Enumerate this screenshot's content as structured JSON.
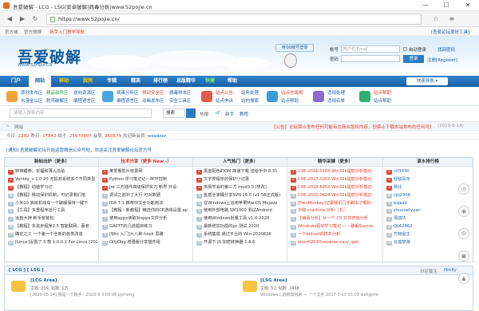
{
  "window": {
    "title": "吾爱破解 - LCG - LSG|安卓破解|病毒分析|www.52pojie.cn",
    "minimize": "—",
    "maximize": "☐",
    "close": "✕"
  },
  "browser": {
    "url": "https://www.52pojie.cn/"
  },
  "topbar": {
    "home": "官方域",
    "lock": "官方微博",
    "newbie": "新手入门教学导航",
    "tools": "[吾爱论坛爱好工具]"
  },
  "header": {
    "logo_text": "吾爱破解",
    "logo_url": "WWW.52PoJie.CN",
    "qq_login": "用QQ帐号登录",
    "account_label": "帐号",
    "account_placeholder": "用户名/Email",
    "password_label": "密码",
    "remember": "自动登录",
    "forgot": "找回密码",
    "login": "登录",
    "register": "注册[Register]"
  },
  "nav": {
    "items": [
      "门户",
      "网站",
      "移动",
      "脱壳",
      "专辑",
      "精英",
      "排行榜",
      "总版精华",
      "快捷",
      "帮助"
    ],
    "active_index": 1,
    "quick": "快速导航 ▾"
  },
  "subnav": {
    "groups": [
      {
        "a": "原创发布区",
        "b": "精品软件区",
        "c": "逆向资源区",
        "d": "水漫金山区",
        "e": "脱壳破解区",
        "f": "编程语言区"
      },
      {
        "a": "病毒分析区",
        "b": "移动安全区",
        "c": "病毒样本区",
        "d": "编程语言区",
        "e": "动画发布区",
        "f": "安全工具区"
      },
      {
        "a": "站点公告",
        "b": "站点申诉",
        "c": "悬赏任务"
      },
      {
        "a": "站务处理",
        "b": "站内搜索",
        "c": "站内问答"
      },
      {
        "a": "站点总版规",
        "b": "站点帮助"
      },
      {
        "a": "违规处理",
        "b": "违规名单"
      },
      {
        "a": "站点帮助",
        "b": "站点帮助"
      }
    ]
  },
  "search": {
    "placeholder": "请输入搜索内容",
    "select": "搜索",
    "hot_label": "热搜:",
    "hot": [
      "cf",
      "新手",
      "教程"
    ]
  },
  "crumb": {
    "home": "网站",
    "sub": "网站"
  },
  "notice": {
    "text": "【公告】论坛禁止发布任何可能有在商业版权内容，但禁止下载本站发布的任何可执行资源...",
    "date": "(2019-6-14)"
  },
  "stats": {
    "today_label": "今日:",
    "today": "2282",
    "yesterday_label": "昨日:",
    "yesterday": "17842",
    "posts_label": "帖子:",
    "posts": "25970907",
    "members_label": "会员:",
    "members": "960579",
    "newest_label": "欢迎新会员:",
    "newest": "wsadzzz"
  },
  "link_notice": {
    "text": "[通知] 吾爱破解论坛开始运营微信公众号啦，欢迎关注吾爱破解论坛官方号"
  },
  "table": {
    "headers": [
      "新帖出炉（更多）",
      "技术分享（更多 New -）",
      "人气热门（更多）",
      "精华采撷（更多）",
      "滚水排行榜"
    ],
    "col1": [
      "转锦鲤券，祈福和薄入瓜贴",
      "Ventoy_v 1.0.20 无损双系统多个不同类型",
      "【教程】动脑学习记",
      "【教程】移动保护机制，可记录我们信",
      "小米10 高级机动车一个破解保持一键下",
      "【工具】多重程序运行工具",
      "运盘大神 新手安装包",
      "【教程】多进步程序2.5 智能联网，蔡老",
      "确定之工 一个第一个全新的各类改造",
      "[Linux]设置了 5 款 1.0.0.1 For Linux [202"
    ],
    "col2": [
      "某爱看影片收录网",
      "Python 学习笔记记---MTF控制",
      "Jre 三方插件高级保护实力 新界 外设",
      "调试之前补丁大行 可对数据",
      "IDA 7.1 推荐中文全功能用法",
      "【教程 - 新教程】精选你的CE游戏设置 ap",
      "使用appx读取对appx文件分析",
      "GACTF的几道题目练习",
      "[Win 入门]九八种 hook 思路",
      "OllyDbg 增强版分享插件组"
    ],
    "col3": [
      "黑金配色的OM 高速下载 送给手中 8.31",
      "文字类程序的保护小记录",
      "简易学会的第三方 mod3.0 (修改)",
      "金盾全家桶分享SVN 16.0 (v1.58正式版)",
      "在Windows上运用苹果MacOS Mojave",
      "使用外部电路 SM1000 测试Android",
      "使用Windows批量工具 v1.0-2020",
      "最新增加功能的pc 测试 2020",
      "系统集成 通过平台的 Win-2020826",
      "开源下 JS 加密转换器 1.8.6"
    ],
    "col4": [
      "CVE-2016-0165 Win32k提权分析笔记",
      "CVE-2017-0263 Win32k提权分析笔记",
      "CVE-2018-8453 Win32k提权分析笔记",
      "CVE-2020-0624 Win32k提权分析笔记",
      "[PwnMonkey]记录我们几乎刷出了哪好",
      "中级 crackme 分析（五）",
      "【病毒分析】从一个 CS 文件开始分析",
      "Windows驱动学习笔记 ——破解Source",
      "一个botnet的样本分析",
      "wmctf2020 reverse easy_apk"
    ],
    "col5": [
      "ctl3330",
      "轻锐青年",
      "杨比",
      "cjtj2308",
      "bsjasd",
      "zhuxuetyuan",
      "周鸽华",
      "QL62862",
      "万物诞生",
      "云落梦游"
    ]
  },
  "lcg": {
    "title": "[ LCG ] [ LSG ]",
    "mod_label": "分区版主:",
    "mod": "Hmily",
    "left": {
      "name": "[LCG Area]",
      "desc": "主题: 239, 帖数: 1万",
      "last": "[2020-05-24] 我是一个新手，2020-9-3 00:06 pymong"
    },
    "right": {
      "name": "[LSG Area]",
      "desc": "主题: 51, 帖数: 2468",
      "last": "Windows二进制如何来 — 一个文件 2017-3-13 15:03 wellgone"
    }
  },
  "colors": {
    "nav_bg": "#1c5fa3",
    "hot": "#e0493c",
    "link": "#1c5fa3"
  }
}
